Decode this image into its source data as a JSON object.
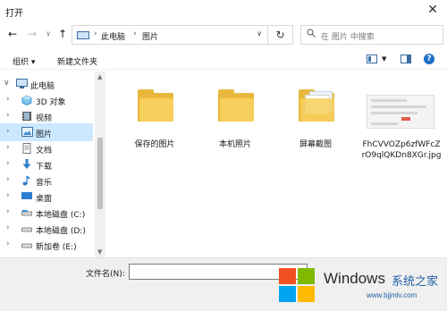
{
  "window": {
    "title": "打开",
    "close_glyph": "✕"
  },
  "nav": {
    "back_glyph": "←",
    "forward_glyph": "→",
    "recent_glyph": "∨",
    "up_glyph": "↑",
    "breadcrumb": [
      "此电脑",
      "图片"
    ],
    "separator_glyph": "›",
    "dropdown_glyph": "∨",
    "refresh_glyph": "↻"
  },
  "search": {
    "placeholder": "在 图片 中搜索",
    "icon": "search-icon"
  },
  "toolbar": {
    "organize_label": "组织 ▾",
    "new_folder_label": "新建文件夹",
    "help_glyph": "?"
  },
  "sidebar": {
    "items": [
      {
        "label": "此电脑",
        "icon": "pc-icon",
        "chevron": "∨"
      },
      {
        "label": "3D 对象",
        "icon": "cube-icon",
        "chevron": "›"
      },
      {
        "label": "视频",
        "icon": "video-icon",
        "chevron": "›"
      },
      {
        "label": "图片",
        "icon": "picture-icon",
        "chevron": "›"
      },
      {
        "label": "文档",
        "icon": "document-icon",
        "chevron": "›"
      },
      {
        "label": "下载",
        "icon": "download-icon",
        "chevron": "›"
      },
      {
        "label": "音乐",
        "icon": "music-icon",
        "chevron": "›"
      },
      {
        "label": "桌面",
        "icon": "desktop-icon",
        "chevron": "›"
      },
      {
        "label": "本地磁盘 (C:)",
        "icon": "drive-icon",
        "chevron": "›"
      },
      {
        "label": "本地磁盘 (D:)",
        "icon": "drive-icon",
        "chevron": "›"
      },
      {
        "label": "新加卷 (E:)",
        "icon": "drive-icon",
        "chevron": "›"
      }
    ],
    "selected": "图片"
  },
  "files": [
    {
      "name": "保存的图片",
      "type": "folder"
    },
    {
      "name": "本机照片",
      "type": "folder"
    },
    {
      "name": "屏幕截图",
      "type": "folder-with-content"
    },
    {
      "name": "FhCVVOZp6zfWFcZrO9qlQKDn8XGr.jpg",
      "type": "image"
    }
  ],
  "footer": {
    "filename_label": "文件名(N):",
    "filename_value": ""
  },
  "watermark": {
    "brand": "Windows",
    "cn": "系统之家",
    "url": "www.bjjmlv.com"
  },
  "colors": {
    "selected_bg": "#cce8ff",
    "folder": "#f6cf5c",
    "accent": "#1f6fc5"
  }
}
